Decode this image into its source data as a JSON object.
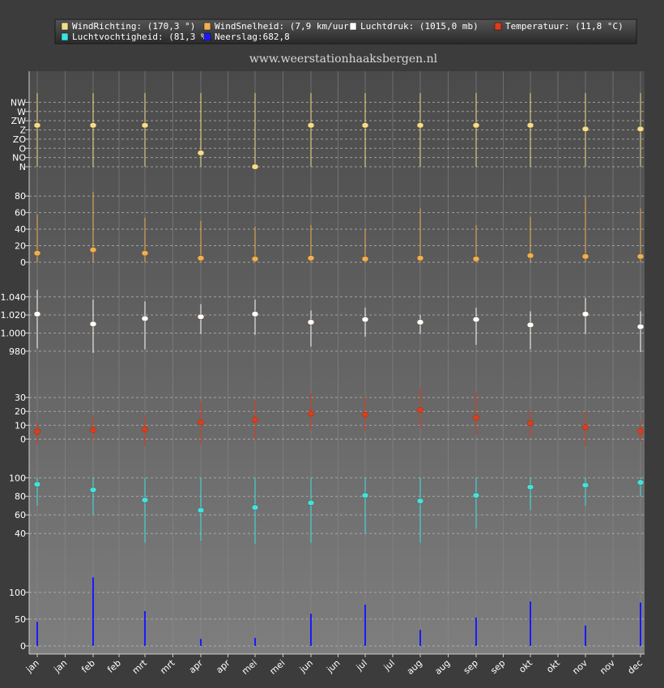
{
  "chart_data": {
    "type": "line",
    "watermark": "www.weerstationhaaksbergen.nl",
    "legend": [
      {
        "label": "WindRichting: (170,3 °)",
        "color": "#f3de8a"
      },
      {
        "label": "WindSnelheid: (7,9 km/uur)",
        "color": "#f0b050"
      },
      {
        "label": "Luchtdruk: (1015,0 mb)",
        "color": "#ffffff"
      },
      {
        "label": "Temperatuur: (11,8 °C)",
        "color": "#e23a1a"
      },
      {
        "label": "Luchtvochtigheid: (81,3 %)",
        "color": "#3ee3e3"
      },
      {
        "label": "Neerslag:682,8",
        "color": "#1a1aff"
      }
    ],
    "x_labels": [
      "jan",
      "jan",
      "feb",
      "feb",
      "mrt",
      "mrt",
      "apr",
      "apr",
      "mei",
      "mei",
      "jun",
      "jun",
      "jul",
      "jul",
      "aug",
      "aug",
      "sep",
      "sep",
      "okt",
      "okt",
      "nov",
      "nov",
      "dec"
    ],
    "months": [
      "jan",
      "feb",
      "mrt",
      "apr",
      "mei",
      "jun",
      "jul",
      "aug",
      "sep",
      "okt",
      "nov",
      "dec"
    ],
    "panels": [
      {
        "id": "windrichting",
        "color": "#f3de8a",
        "ylim": [
          0,
          8
        ],
        "tick_labels": [
          "N",
          "NO",
          "O",
          "ZO",
          "Z",
          "ZW",
          "W",
          "NW"
        ],
        "tick_values": [
          0,
          1,
          2,
          3,
          4,
          5,
          6,
          7
        ],
        "values": [
          4.5,
          4.5,
          4.5,
          1.5,
          0,
          4.5,
          4.5,
          4.5,
          4.5,
          4.5,
          4.1,
          4.1
        ],
        "low": [
          0,
          0,
          0,
          0,
          0,
          0,
          0,
          0,
          0,
          0,
          0,
          0
        ],
        "high": [
          8,
          8,
          8,
          8,
          8,
          8,
          8,
          8,
          8,
          8,
          8,
          8
        ]
      },
      {
        "id": "windsnelheid",
        "color": "#f0b050",
        "ylim": [
          0,
          90
        ],
        "tick_labels": [
          "0",
          "20",
          "40",
          "60",
          "80"
        ],
        "tick_values": [
          0,
          20,
          40,
          60,
          80
        ],
        "values": [
          11,
          15,
          11,
          5,
          4,
          5,
          4,
          5,
          4,
          8,
          7,
          7
        ],
        "low": [
          0,
          0,
          0,
          0,
          0,
          0,
          0,
          0,
          0,
          0,
          0,
          0
        ],
        "high": [
          58,
          85,
          54,
          50,
          43,
          45,
          40,
          65,
          45,
          55,
          80,
          65
        ]
      },
      {
        "id": "luchtdruk",
        "color": "#ffffff",
        "ylim": [
          970,
          1055
        ],
        "tick_labels": [
          "980",
          "1.000",
          "1.020",
          "1.040"
        ],
        "tick_values": [
          980,
          1000,
          1020,
          1040
        ],
        "values": [
          1021,
          1010,
          1016,
          1018,
          1021,
          1012,
          1015,
          1012,
          1015,
          1009,
          1021,
          1007
        ],
        "low": [
          983,
          978,
          982,
          999,
          998,
          985,
          996,
          999,
          987,
          982,
          999,
          979
        ],
        "high": [
          1048,
          1037,
          1035,
          1032,
          1037,
          1025,
          1028,
          1020,
          1028,
          1024,
          1039,
          1024
        ]
      },
      {
        "id": "temperatuur",
        "color": "#e23a1a",
        "ylim": [
          -5,
          40
        ],
        "tick_labels": [
          "0",
          "10",
          "20",
          "30"
        ],
        "tick_values": [
          0,
          10,
          20,
          30
        ],
        "values": [
          5.5,
          6.5,
          7,
          12,
          14,
          18.5,
          17.5,
          21,
          15.5,
          11.5,
          8.5,
          5.5
        ],
        "low": [
          -4,
          -1,
          -5,
          -4,
          -1,
          7,
          6,
          8,
          3,
          1,
          -5,
          -2
        ],
        "high": [
          12,
          17,
          17,
          27,
          28,
          33,
          31,
          37,
          34,
          21,
          20,
          13
        ]
      },
      {
        "id": "luchtvochtigheid",
        "color": "#3ee3e3",
        "ylim": [
          20,
          102
        ],
        "tick_labels": [
          "40",
          "60",
          "80",
          "100"
        ],
        "tick_values": [
          40,
          60,
          80,
          100
        ],
        "values": [
          93,
          87,
          76,
          65,
          68,
          73,
          81,
          75,
          81,
          90,
          92,
          95
        ],
        "low": [
          70,
          60,
          30,
          32,
          29,
          30,
          40,
          30,
          45,
          65,
          70,
          80
        ],
        "high": [
          100,
          100,
          100,
          100,
          100,
          100,
          100,
          100,
          100,
          100,
          100,
          100
        ]
      },
      {
        "id": "neerslag",
        "color": "#1a1aff",
        "type": "bar",
        "ylim": [
          0,
          130
        ],
        "tick_labels": [
          "0",
          "50",
          "100"
        ],
        "tick_values": [
          0,
          50,
          100
        ],
        "values": [
          45,
          128,
          65,
          13,
          15,
          60,
          77,
          30,
          53,
          83,
          38,
          81
        ]
      }
    ]
  }
}
